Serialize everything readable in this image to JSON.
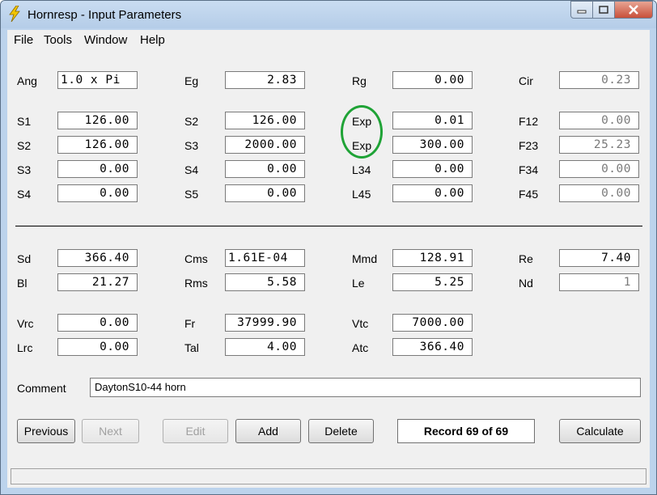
{
  "window": {
    "title": "Hornresp - Input Parameters",
    "accent": "#bcd3ec",
    "icons": {
      "app": "lightning-bolt-icon",
      "minimize": "minimize-icon",
      "maximize": "maximize-icon",
      "close": "close-icon"
    }
  },
  "menu": {
    "file": "File",
    "tools": "Tools",
    "window": "Window",
    "help": "Help"
  },
  "horn": {
    "ang_label": "Ang",
    "ang_value": "1.0 x Pi",
    "eg_label": "Eg",
    "eg_value": "2.83",
    "rg_label": "Rg",
    "rg_value": "0.00",
    "cir_label": "Cir",
    "cir_value": "0.23",
    "r1": {
      "l1": "S1",
      "v1": "126.00",
      "l2": "S2",
      "v2": "126.00",
      "l3": "Exp",
      "v3": "0.01",
      "l4": "F12",
      "v4": "0.00"
    },
    "r2": {
      "l1": "S2",
      "v1": "126.00",
      "l2": "S3",
      "v2": "2000.00",
      "l3": "Exp",
      "v3": "300.00",
      "l4": "F23",
      "v4": "25.23"
    },
    "r3": {
      "l1": "S3",
      "v1": "0.00",
      "l2": "S4",
      "v2": "0.00",
      "l3": "L34",
      "v3": "0.00",
      "l4": "F34",
      "v4": "0.00"
    },
    "r4": {
      "l1": "S4",
      "v1": "0.00",
      "l2": "S5",
      "v2": "0.00",
      "l3": "L45",
      "v3": "0.00",
      "l4": "F45",
      "v4": "0.00"
    }
  },
  "driver": {
    "d1": {
      "l1": "Sd",
      "v1": "366.40",
      "l2": "Cms",
      "v2": "1.61E-04",
      "l3": "Mmd",
      "v3": "128.91",
      "l4": "Re",
      "v4": "7.40"
    },
    "d2": {
      "l1": "Bl",
      "v1": "21.27",
      "l2": "Rms",
      "v2": "5.58",
      "l3": "Le",
      "v3": "5.25",
      "l4": "Nd",
      "v4": "1"
    }
  },
  "chamber": {
    "c1": {
      "l1": "Vrc",
      "v1": "0.00",
      "l2": "Fr",
      "v2": "37999.90",
      "l3": "Vtc",
      "v3": "7000.00"
    },
    "c2": {
      "l1": "Lrc",
      "v1": "0.00",
      "l2": "Tal",
      "v2": "4.00",
      "l3": "Atc",
      "v3": "366.40"
    }
  },
  "comment": {
    "label": "Comment",
    "value": "DaytonS10-44 horn"
  },
  "buttons": {
    "previous": "Previous",
    "next": "Next",
    "edit": "Edit",
    "add": "Add",
    "delete": "Delete",
    "record": "Record 69 of 69",
    "calculate": "Calculate"
  },
  "annotation_color": "#1fa336"
}
